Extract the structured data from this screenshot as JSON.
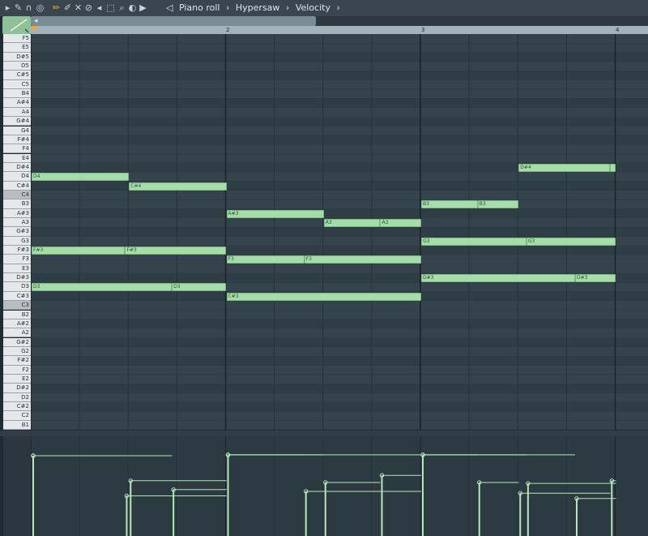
{
  "window": {
    "breadcrumb": [
      "Piano roll",
      "Hypersaw",
      "Velocity"
    ],
    "separator": "›"
  },
  "toolbar": {
    "icons": [
      "menu-arrow-icon",
      "wrench-icon",
      "magnet-icon",
      "stamp-icon",
      "pencil-icon",
      "paint-brush-icon",
      "delete-icon",
      "mute-icon",
      "slice-icon",
      "select-icon",
      "zoom-icon",
      "playback-icon",
      "speaker-icon"
    ]
  },
  "ruler": {
    "bars": [
      "2",
      "3",
      "4"
    ]
  },
  "keyboard": {
    "keys": [
      "F5",
      "E5",
      "D#5",
      "D5",
      "C#5",
      "C5",
      "B4",
      "A#4",
      "A4",
      "G#4",
      "G4",
      "F#4",
      "F4",
      "E4",
      "D#4",
      "D4",
      "C#4",
      "C4",
      "B3",
      "A#3",
      "A3",
      "G#3",
      "G3",
      "F#3",
      "F3",
      "E3",
      "D#3",
      "D3",
      "C#3",
      "C3",
      "B2",
      "A#2",
      "A2",
      "G#2",
      "G2",
      "F#2",
      "F2",
      "E2",
      "D#2",
      "D2",
      "C#2",
      "C2",
      "B1"
    ],
    "highlighted": [
      "C4",
      "C3"
    ]
  },
  "notes": [
    {
      "label": "D4",
      "key": "D4",
      "start": 0.0,
      "len": 0.5,
      "vel": 0.9
    },
    {
      "label": "C#4",
      "key": "C#4",
      "start": 0.5,
      "len": 0.5,
      "vel": 0.62
    },
    {
      "label": "F#3",
      "key": "F#3",
      "start": 0.0,
      "len": 0.48,
      "vel": 0.9
    },
    {
      "label": "F#3",
      "key": "F#3",
      "start": 0.48,
      "len": 0.52,
      "vel": 0.45
    },
    {
      "label": "D3",
      "key": "D3",
      "start": 0.0,
      "len": 0.72,
      "vel": 0.9
    },
    {
      "label": "D3",
      "key": "D3",
      "start": 0.72,
      "len": 0.28,
      "vel": 0.52
    },
    {
      "label": "A#3",
      "key": "A#3",
      "start": 1.0,
      "len": 0.5,
      "vel": 0.91
    },
    {
      "label": "A3",
      "key": "A3",
      "start": 1.5,
      "len": 0.29,
      "vel": 0.6
    },
    {
      "label": "A3",
      "key": "A3",
      "start": 1.79,
      "len": 0.21,
      "vel": 0.68
    },
    {
      "label": "F3",
      "key": "F3",
      "start": 1.0,
      "len": 0.4,
      "vel": 0.91
    },
    {
      "label": "F3",
      "key": "F3",
      "start": 1.4,
      "len": 0.6,
      "vel": 0.5
    },
    {
      "label": "C#3",
      "key": "C#3",
      "start": 1.0,
      "len": 1.0,
      "vel": 0.91
    },
    {
      "label": "B3",
      "key": "B3",
      "start": 2.0,
      "len": 0.29,
      "vel": 0.91
    },
    {
      "label": "B3",
      "key": "B3",
      "start": 2.29,
      "len": 0.21,
      "vel": 0.6
    },
    {
      "label": "G3",
      "key": "G3",
      "start": 2.0,
      "len": 0.54,
      "vel": 0.91
    },
    {
      "label": "G3",
      "key": "G3",
      "start": 2.54,
      "len": 0.46,
      "vel": 0.59
    },
    {
      "label": "D#3",
      "key": "D#3",
      "start": 2.0,
      "len": 0.79,
      "vel": 0.91
    },
    {
      "label": "D#3",
      "key": "D#3",
      "start": 2.79,
      "len": 0.21,
      "vel": 0.42
    },
    {
      "label": "D#4",
      "key": "D#4",
      "start": 2.5,
      "len": 0.47,
      "vel": 0.48
    },
    {
      "label": "",
      "key": "D#4",
      "start": 2.97,
      "len": 0.03,
      "vel": 0.62
    }
  ],
  "colors": {
    "note_fill": "#a6dcaa",
    "note_border": "#7cb981",
    "grid_bg": "#34434c",
    "grid_bg_alt": "#2f3d45",
    "beat_line": "#27333a",
    "bar_line": "#1b252b",
    "velocity_line": "#b8e6bb",
    "playhead": "#f0a43a"
  }
}
